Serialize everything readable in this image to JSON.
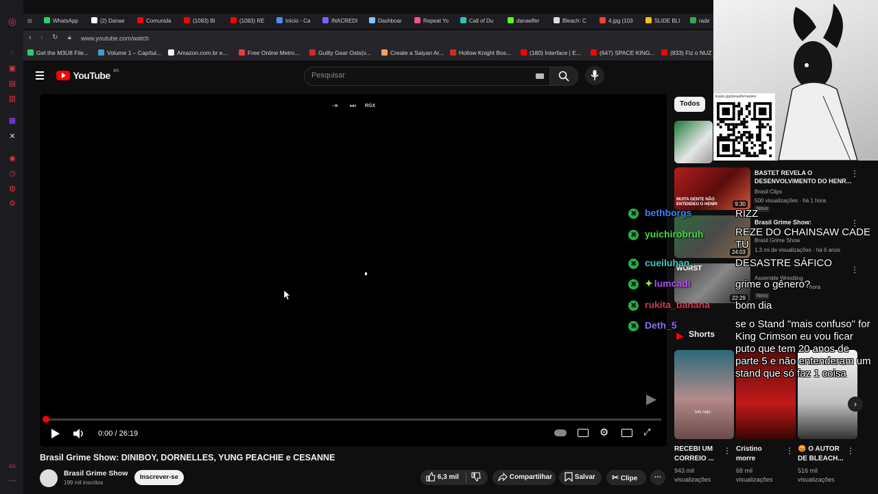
{
  "tabs": [
    {
      "label": "WhatsApp",
      "color": "#25d366"
    },
    {
      "label": "(2) Danae",
      "color": "#ffffff"
    },
    {
      "label": "Comunida",
      "color": "#ff0000"
    },
    {
      "label": "(1083) Bl",
      "color": "#ff0000"
    },
    {
      "label": "(1083) RE",
      "color": "#ff0000"
    },
    {
      "label": "Início - Ca",
      "color": "#4a8cff"
    },
    {
      "label": "INACREDI",
      "color": "#7b61ff"
    },
    {
      "label": "Dashboar",
      "color": "#89c4f4"
    },
    {
      "label": "Repeat Yo",
      "color": "#ff4e8a"
    },
    {
      "label": "Call of Du",
      "color": "#2ec4b6"
    },
    {
      "label": "danaelfer",
      "color": "#53fc18"
    },
    {
      "label": "Bleach: C",
      "color": "#dddddd"
    },
    {
      "label": "4.jpg (103",
      "color": "#ff3b3b"
    },
    {
      "label": "SLIDE BLI",
      "color": "#f4c20d"
    },
    {
      "label": "rada",
      "color": "#34a853"
    }
  ],
  "url": "www.youtube.com/watch",
  "bookmarks": [
    {
      "label": "Get the M3U8 File...",
      "color": "#2ecc71"
    },
    {
      "label": "Volume 1 – Capítul...",
      "color": "#3fa0c8"
    },
    {
      "label": "Amazon.com.br e...",
      "color": "#f5f5f5"
    },
    {
      "label": "Free Online Metro...",
      "color": "#e63946"
    },
    {
      "label": "Guilty Gear Osts(v...",
      "color": "#d62828"
    },
    {
      "label": "Create a Saiyan Ar...",
      "color": "#f4a261"
    },
    {
      "label": "Hollow Knight Bos...",
      "color": "#d62828"
    },
    {
      "label": "(180) Interface | E...",
      "color": "#ff0000"
    },
    {
      "label": "(647) SPACE KING...",
      "color": "#ff0000"
    },
    {
      "label": "(833) Fiz o NUZ",
      "color": "#ff0000"
    }
  ],
  "youtube": {
    "logo_text": "YouTube",
    "region": "BR",
    "search_placeholder": "Pesquisar"
  },
  "player": {
    "time": "0:00 / 26:19",
    "top_badge": "RGX",
    "progress": 0.0
  },
  "video": {
    "title": "Brasil Grime Show: DINIBOY, DORNELLES, YUNG PEACHIE e CESANNE",
    "channel": "Brasil Grime Show",
    "subscribers": "199 mil inscritos",
    "subscribe_label": "Inscrever-se",
    "likes": "6,3 mil",
    "share_label": "Compartilhar",
    "save_label": "Salvar",
    "clip_label": "Clipe"
  },
  "chips": {
    "all": "Todos"
  },
  "qr_url": "livepix.gg/danaelfernandes",
  "related": [
    {
      "title_line1": "BASTET REVELA O",
      "title_line2": "DESENVOLVIMENTO DO HENR...",
      "channel": "Brasil Clips",
      "meta": "500 visualizações · há 1 hora",
      "duration": "9:30",
      "badge": "Novo",
      "thumb_text": "MUITA GENTE NÃO ENTENDEU O HENRI"
    },
    {
      "title_line1": "Brasil Grime Show:",
      "title_line2": "",
      "channel": "Brasil Grime Show",
      "meta": "1,3 mi de visualizações · há 6 anos",
      "duration": "24:03"
    },
    {
      "title_line1": "",
      "title_line2": "",
      "channel": "Assemble Wrestling",
      "meta": "hora",
      "duration": "22:29",
      "badge": "Novo",
      "thumb_text": "WORST"
    }
  ],
  "shorts": {
    "header": "Shorts",
    "items": [
      {
        "title_line1": "RECEBI UM",
        "title_line2": "CORREIO ...",
        "views_line1": "943 mil",
        "views_line2": "visualizações",
        "thumb_caption": "tuts nojo"
      },
      {
        "title_line1": "Cristino",
        "title_line2": "morre",
        "views_line1": "68 mil",
        "views_line2": "visualizações"
      },
      {
        "title_line1": "😡 O AUTOR",
        "title_line2": "DE BLEACH...",
        "views_line1": "516 mil",
        "views_line2": "visualizações"
      }
    ]
  },
  "chat_users": [
    {
      "name": "bethborgs",
      "color": "#3b7ff5"
    },
    {
      "name": "yuichirobruh",
      "color": "#43d94a"
    },
    {
      "name": "cueiluhan",
      "color": "#40c9b5"
    },
    {
      "name": "lumcadi",
      "color": "#b04df2",
      "extra": "✦"
    },
    {
      "name": "rukita_banana",
      "color": "#e0334a"
    },
    {
      "name": "Deth_5",
      "color": "#8f6cf0"
    }
  ],
  "chat_messages": [
    {
      "text": "RIZZ"
    },
    {
      "text": "REZE DO CHAINSAW CADE TU"
    },
    {
      "text": "DESASTRE SÁFICO"
    },
    {
      "text": "grime o gênero?"
    },
    {
      "text": "bom dia"
    },
    {
      "text": "se o Stand \"mais confuso\" for King Crimson eu vou ficar puto que tem 20 anos de parte 5 e não entenderam um stand que só faz 1 coisa"
    }
  ],
  "colors": {
    "accent": "#ff0000",
    "chat_check": "#27b24a",
    "background": "#0f0f0f"
  }
}
